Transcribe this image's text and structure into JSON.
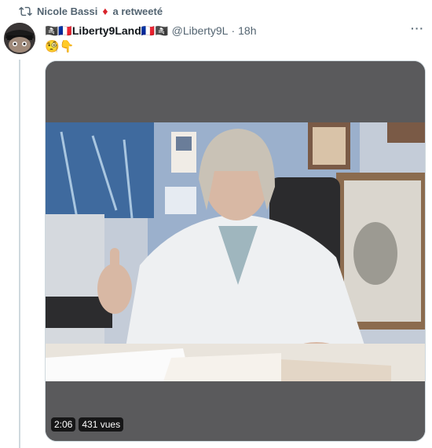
{
  "retweet": {
    "name": "Nicole Bassi",
    "suffix": "a retweeté"
  },
  "tweet": {
    "display_name_prefix": "🏴‍☠️🇫🇷",
    "display_name": "Liberty9Land",
    "display_name_suffix": "🇫🇷🏴‍☠️",
    "handle": "@Liberty9L",
    "separator": "·",
    "time": "18h",
    "text": "🧐👇"
  },
  "video": {
    "duration": "2:06",
    "views": "431 vues"
  },
  "colors": {
    "secondary_text": "#536471",
    "video_frame": "#5a5a5c"
  },
  "icons": {
    "retweet": "retweet-icon",
    "more": "more-options-icon"
  }
}
